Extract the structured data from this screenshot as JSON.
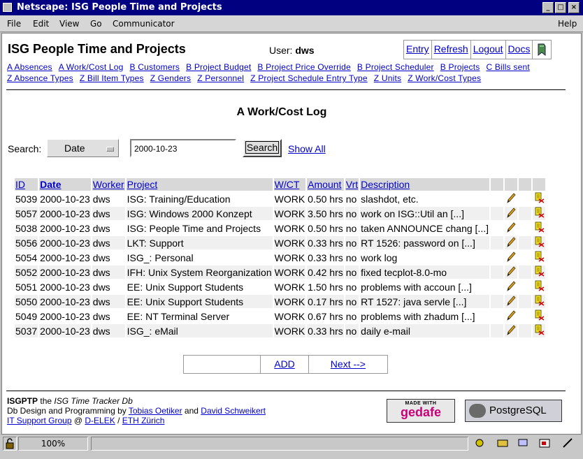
{
  "window": {
    "title": "Netscape: ISG People Time and Projects"
  },
  "menu": [
    "File",
    "Edit",
    "View",
    "Go",
    "Communicator"
  ],
  "menu_help": "Help",
  "app": {
    "title": "ISG People Time and Projects",
    "user_label": "User:",
    "user": "dws"
  },
  "topnav": [
    "Entry",
    "Refresh",
    "Logout",
    "Docs"
  ],
  "table_links_row1": [
    "A Absences",
    "A Work/Cost Log",
    "B Customers",
    "B Project Budget",
    "B Project Price Override",
    "B Project Scheduler",
    "B Projects",
    "C Bills sent"
  ],
  "table_links_row2": [
    "Z Absence Types",
    "Z Bill Item Types",
    "Z Genders",
    "Z Personnel",
    "Z Project Schedule Entry Type",
    "Z Units",
    "Z Work/Cost Types"
  ],
  "page_title": "A Work/Cost Log",
  "search": {
    "label": "Search:",
    "field": "Date",
    "value": "2000-10-23",
    "button": "Search",
    "show_all": "Show All"
  },
  "columns": [
    "ID",
    "Date",
    "Worker",
    "Project",
    "W/CT",
    "Amount",
    "Vrt",
    "Description"
  ],
  "rows": [
    {
      "id": "5039",
      "date": "2000-10-23",
      "worker": "dws",
      "project": "ISG: Training/Education",
      "wct": "WORK",
      "amount": "0.50 hrs",
      "vrt": "no",
      "desc": "slashdot, etc."
    },
    {
      "id": "5057",
      "date": "2000-10-23",
      "worker": "dws",
      "project": "ISG: Windows 2000 Konzept",
      "wct": "WORK",
      "amount": "3.50 hrs",
      "vrt": "no",
      "desc": "work on ISG::Util an [...]"
    },
    {
      "id": "5038",
      "date": "2000-10-23",
      "worker": "dws",
      "project": "ISG: People Time and Projects",
      "wct": "WORK",
      "amount": "0.50 hrs",
      "vrt": "no",
      "desc": "taken ANNOUNCE chang [...]"
    },
    {
      "id": "5056",
      "date": "2000-10-23",
      "worker": "dws",
      "project": "LKT: Support",
      "wct": "WORK",
      "amount": "0.33 hrs",
      "vrt": "no",
      "desc": "RT 1526: password on [...]"
    },
    {
      "id": "5054",
      "date": "2000-10-23",
      "worker": "dws",
      "project": "ISG_: Personal",
      "wct": "WORK",
      "amount": "0.33 hrs",
      "vrt": "no",
      "desc": "work log"
    },
    {
      "id": "5052",
      "date": "2000-10-23",
      "worker": "dws",
      "project": "IFH: Unix System Reorganization",
      "wct": "WORK",
      "amount": "0.42 hrs",
      "vrt": "no",
      "desc": "fixed tecplot-8.0-mo"
    },
    {
      "id": "5051",
      "date": "2000-10-23",
      "worker": "dws",
      "project": "EE: Unix Support Students",
      "wct": "WORK",
      "amount": "1.50 hrs",
      "vrt": "no",
      "desc": "problems with accoun [...]"
    },
    {
      "id": "5050",
      "date": "2000-10-23",
      "worker": "dws",
      "project": "EE: Unix Support Students",
      "wct": "WORK",
      "amount": "0.17 hrs",
      "vrt": "no",
      "desc": "RT 1527: java servle [...]"
    },
    {
      "id": "5049",
      "date": "2000-10-23",
      "worker": "dws",
      "project": "EE: NT Terminal Server",
      "wct": "WORK",
      "amount": "0.67 hrs",
      "vrt": "no",
      "desc": "problems with zhadum [...]"
    },
    {
      "id": "5037",
      "date": "2000-10-23",
      "worker": "dws",
      "project": "ISG_: eMail",
      "wct": "WORK",
      "amount": "0.33 hrs",
      "vrt": "no",
      "desc": "daily e-mail"
    }
  ],
  "bottom_nav": {
    "add": "ADD",
    "next": "Next -->"
  },
  "footer": {
    "app_short": "ISGPTP",
    "the": "the",
    "tagline": "ISG Time Tracker Db",
    "design_prefix": "Db Design and Programming by",
    "author1": "Tobias Oetiker",
    "and": "and",
    "author2": "David Schweikert",
    "org1": "IT Support Group",
    "at": "@",
    "org2": "D-ELEK",
    "slash": "/",
    "org3": "ETH Zürich"
  },
  "badges": {
    "gedafe_small": "MADE WITH",
    "gedafe": "gedafe",
    "postgres": "PostgreSQL"
  },
  "status": {
    "zoom": "100%"
  },
  "icons": {
    "edit": "pencil-icon",
    "delete": "delete-icon",
    "bookmark": "bookmark-icon"
  }
}
